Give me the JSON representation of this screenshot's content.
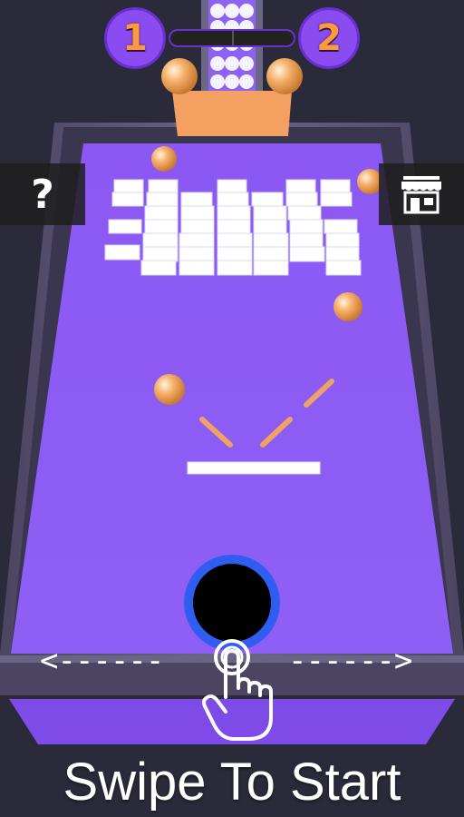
{
  "level": {
    "current": "1",
    "next": "2",
    "progress": 0.0
  },
  "buttons": {
    "help_label": "?",
    "shop_icon": "store-icon"
  },
  "swipe": {
    "left_arrow": "<------",
    "right_arrow": "------>"
  },
  "prompt": {
    "text": "Swipe To Start"
  },
  "colors": {
    "board": "#8b5cf6",
    "frame": "#5a5470",
    "hole_ring": "#2f5df0",
    "ball": "#f2a35c",
    "accent": "#ff9a3c",
    "badge": "#8a4bf0"
  },
  "game": {
    "balls_on_board": 5,
    "blocks": {
      "rows": 6,
      "cols": 7
    }
  }
}
